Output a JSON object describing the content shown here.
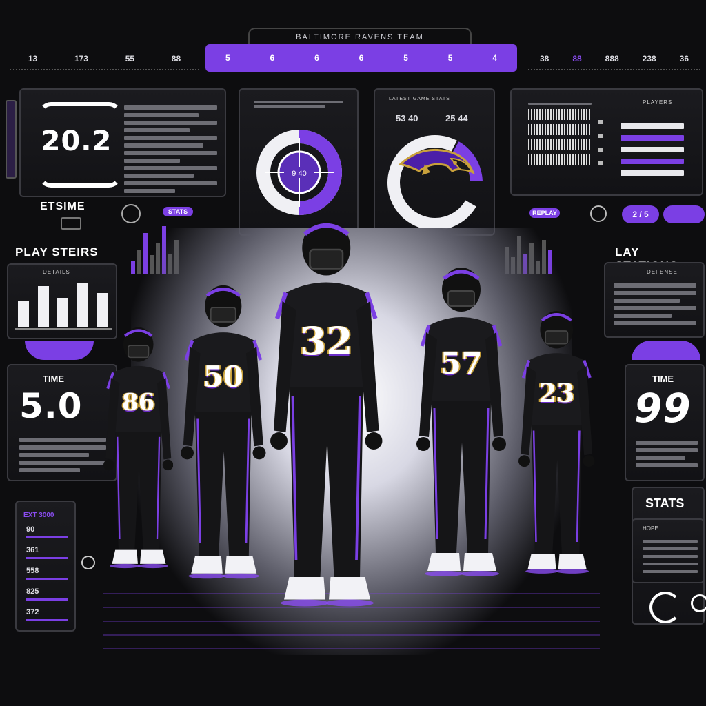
{
  "header": {
    "title": "BALTIMORE RAVENS TEAM",
    "left_ticks": [
      "13",
      "173",
      "55",
      "88"
    ],
    "nav_ticks": [
      "5",
      "6",
      "6",
      "6",
      "5",
      "5",
      "4"
    ],
    "right_ticks": [
      "38",
      "88",
      "888",
      "238",
      "36"
    ]
  },
  "left_top": {
    "score": "20.2",
    "label": "ETSIME"
  },
  "left_mid": {
    "section": "PLAY STEIRS",
    "chart_label": "DETAILS",
    "bars": [
      0.55,
      0.85,
      0.6,
      0.9,
      0.7
    ],
    "stat_label": "TIME",
    "stat_value": "5.0"
  },
  "left_bottom": {
    "title": "EXT 3000",
    "rows": [
      "90",
      "361",
      "558",
      "825",
      "372"
    ]
  },
  "donut_panel": {
    "center": "9 40",
    "fill_fraction": 0.5
  },
  "logo_panel": {
    "header": "LATEST GAME STATS",
    "values": [
      "53 40",
      "25 44"
    ],
    "gauge_fraction": 0.4
  },
  "right_top": {
    "header": "PLAYERS"
  },
  "right_mid": {
    "section": "LAY STATIONS",
    "sub": "DEFENSE",
    "stat_label": "TIME",
    "stat_value": "99"
  },
  "right_bottom": {
    "title": "STATS",
    "sub": "HOPE"
  },
  "pills": {
    "left": "STATS",
    "right": "REPLAY",
    "toggle_a": "2 / 5",
    "toggle_b": ""
  },
  "players": [
    {
      "number": "86"
    },
    {
      "number": "50"
    },
    {
      "number": "32"
    },
    {
      "number": "57"
    },
    {
      "number": "23"
    }
  ],
  "colors": {
    "accent": "#7b3fe4",
    "bg": "#0d0d0f",
    "panel": "#1a1a1e",
    "gold": "#c9a13b"
  }
}
